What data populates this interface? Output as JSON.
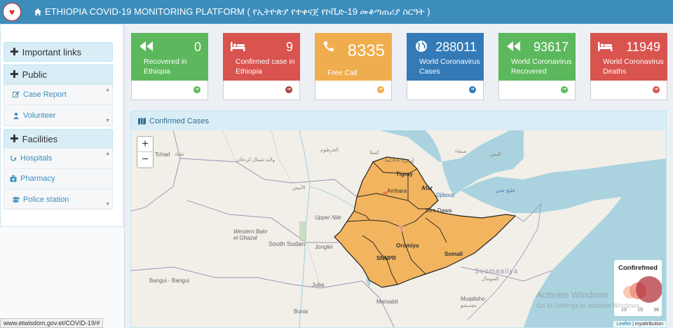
{
  "header": {
    "title": "ETHIOPIA COVID-19 MONITORING PLATFORM ( የኢትዮጵያ የተቀናጀ የኮቪድ-19 መቆጣጠሪያ ስርዓት )"
  },
  "sidebar": {
    "important_links": "Important links",
    "public": {
      "label": "Public",
      "items": [
        "Case Report",
        "Volunteer"
      ]
    },
    "facilities": {
      "label": "Facilities",
      "items": [
        "Hospitals",
        "Pharmacy",
        "Police station"
      ]
    }
  },
  "stats": [
    {
      "value": "0",
      "label": "Recovered in Ethiopia",
      "color": "#5cb85c",
      "icon": "fast-backward-icon"
    },
    {
      "value": "9",
      "label": "Confirmed case in Ethiopia",
      "color": "#d9534f",
      "icon": "bed-icon"
    },
    {
      "value": "8335",
      "label": "Free Call",
      "color": "#f0ad4e",
      "icon": "phone-icon"
    },
    {
      "value": "288011",
      "label": "World Coronavirus Cases",
      "color": "#337ab7",
      "icon": "globe-icon"
    },
    {
      "value": "93617",
      "label": "World Coronavirus Recovered",
      "color": "#5cb85c",
      "icon": "fast-backward-icon"
    },
    {
      "value": "11949",
      "label": "World Coronavirus Deaths",
      "color": "#d9534f",
      "icon": "bed-icon"
    }
  ],
  "map": {
    "panel_title": "Confirmed Cases",
    "zoom_in": "+",
    "zoom_out": "−",
    "legend_title": "Confirefmed",
    "legend_values": [
      "13",
      "19",
      "38"
    ],
    "attribution_leaflet": "Leaflet",
    "attribution_rest": " | myattribution",
    "labels": {
      "chad": "Tchad",
      "chad_ar": "تشاد",
      "khartoum_ar": "الخرطوم",
      "kassala_ar": "كسلا",
      "eritrea": "ኤርትራ إرتريا",
      "sanaa_ar": "صنعاء",
      "yemen_ar": "اليمن",
      "tigray": "Tigray",
      "amhara": "Amhara",
      "afar": "Afar",
      "djibouti": "Djibouti",
      "dire_dawa": "Dire Dawa",
      "oromiya": "Oromiya",
      "snnpr": "SNNPR",
      "somali": "Somali",
      "south_sudan": "South Sudan",
      "upper_nile": "Upper Nile",
      "jonglei": "Jonglei",
      "western_bahr": "Western Bahr el Ghazal",
      "juba": "Juba",
      "bangui": "Bangui - Bangui",
      "bunia": "Bunia",
      "mogadishu": "Muqdisho",
      "mogadishu_ar": "مقديشو",
      "somaliya": "Soomaaliya",
      "somaliya_ar": "الصومال",
      "marsabit": "Marsabit",
      "aden_gulf_ar": "خليج عدن",
      "kurdufan_ar": "ولاية شمال كردفان",
      "obeid_ar": "الأبيض"
    }
  },
  "watermark": {
    "title": "Activate Windows",
    "subtitle": "Go to Settings to activate Windows."
  },
  "statusbar": "www.etwisdom.gov.et/COVID-19/#"
}
